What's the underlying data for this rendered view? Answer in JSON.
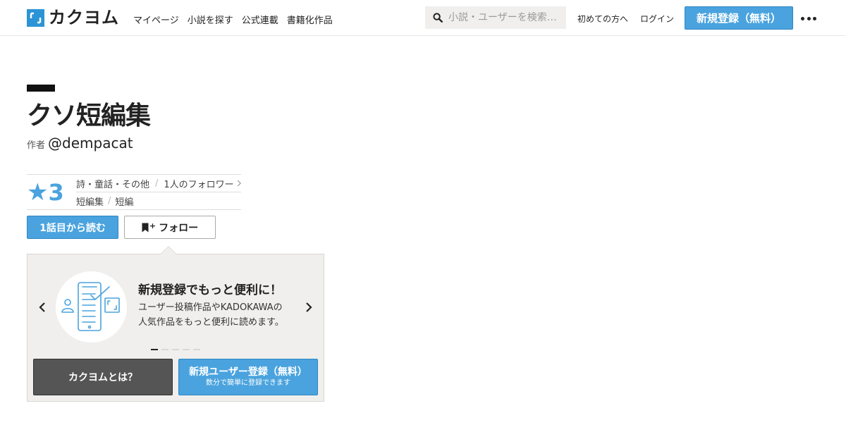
{
  "header": {
    "logo_text": "カクヨム",
    "nav": [
      {
        "label": "マイページ"
      },
      {
        "label": "小説を探す"
      },
      {
        "label": "公式連載"
      },
      {
        "label": "書籍化作品"
      }
    ],
    "search_placeholder": "小説・ユーザーを検索…",
    "first_time_label": "初めての方へ",
    "login_label": "ログイン",
    "signup_label": "新規登録（無料）"
  },
  "work": {
    "title": "クソ短編集",
    "author_label": "作者",
    "author_name": "@dempacat",
    "star_glyph": "★",
    "star_count": "3",
    "genre": "詩・童話・その他",
    "followers": "1人のフォロワー",
    "tag_1": "短編集",
    "tag_2": "短編",
    "read_first_label": "1話目から読む",
    "follow_plus": "+",
    "follow_label": "フォロー"
  },
  "promo": {
    "heading": "新規登録でもっと便利に！",
    "body_line1": "ユーザー投稿作品やKADOKAWAの",
    "body_line2": "人気作品をもっと便利に読めます。",
    "slide_count": 5,
    "active_slide": 1,
    "about_label": "カクヨムとは？",
    "register_label": "新規ユーザー登録（無料）",
    "register_sub": "数分で簡単に登録できます"
  },
  "colors": {
    "accent": "#4aa3de",
    "dark_button": "#555555",
    "panel_bg": "#f0efed"
  },
  "icons": [
    "kakuyomu-logo-icon",
    "search-icon",
    "more-dots-icon",
    "star-icon",
    "chevron-right-icon",
    "bookmark-icon",
    "chevron-left-icon",
    "phone-illustration-icon"
  ]
}
